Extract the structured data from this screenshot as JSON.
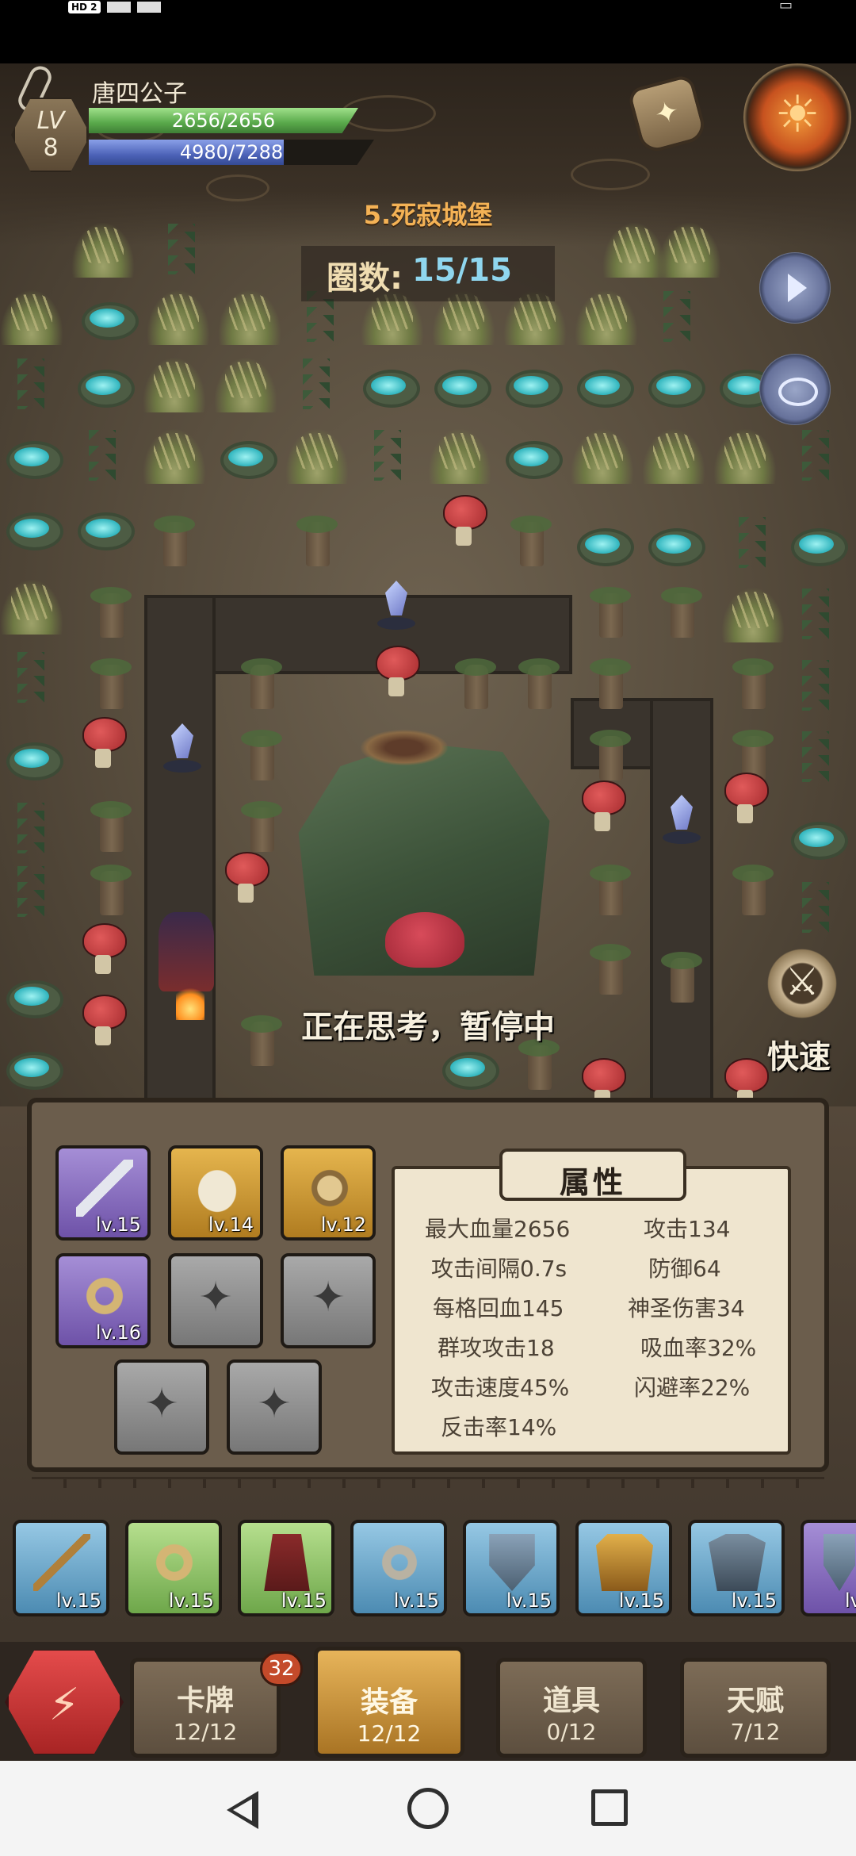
{
  "status_bar": {
    "network_badge": "HD 2"
  },
  "player": {
    "name": "唐四公子",
    "level_label": "LV",
    "level": "8",
    "hp_text": "2656/2656",
    "hp_fraction": 1.0,
    "exp_text": "4980/7288",
    "exp_fraction": 0.683
  },
  "stage": {
    "name": "5.死寂城堡",
    "round_label": "圈数:",
    "round_value": "15/15"
  },
  "status_message": "正在思考，暂停中",
  "speed_button_label": "快速",
  "equipped_slots": [
    {
      "item": "sword-icon",
      "rarity": "purple",
      "level": "lv.15"
    },
    {
      "item": "armor-icon",
      "rarity": "gold",
      "level": "lv.14"
    },
    {
      "item": "shield-icon",
      "rarity": "gold",
      "level": "lv.12"
    },
    {
      "item": "ring-icon",
      "rarity": "purple",
      "level": "lv.16"
    },
    {
      "item": "empty-slot-icon",
      "rarity": "empty",
      "level": ""
    },
    {
      "item": "empty-slot-icon",
      "rarity": "empty",
      "level": ""
    },
    {
      "item": "empty-slot-icon",
      "rarity": "empty",
      "level": ""
    },
    {
      "item": "empty-slot-icon",
      "rarity": "empty",
      "level": ""
    }
  ],
  "attributes": {
    "title": "属性",
    "max_hp": "最大血量2656",
    "attack": "攻击134",
    "attack_interval": "攻击间隔0.7s",
    "defense": "防御64",
    "regen": "每格回血145",
    "holy_damage": "神圣伤害34",
    "aoe_attack": "群攻攻击18",
    "lifesteal": "吸血率32%",
    "attack_speed": "攻击速度45%",
    "dodge": "闪避率22%",
    "counter": "反击率14%"
  },
  "inventory": [
    {
      "item": "staff-icon",
      "rarity": "blue",
      "level": "lv.15"
    },
    {
      "item": "ring-icon",
      "rarity": "green",
      "level": "lv.15"
    },
    {
      "item": "robe-icon",
      "rarity": "green",
      "level": "lv.15"
    },
    {
      "item": "band-icon",
      "rarity": "blue",
      "level": "lv.15"
    },
    {
      "item": "shield-icon",
      "rarity": "blue",
      "level": "lv.15"
    },
    {
      "item": "helmet-icon",
      "rarity": "blue",
      "level": "lv.15"
    },
    {
      "item": "chainmail-icon",
      "rarity": "blue",
      "level": "lv.15"
    },
    {
      "item": "shield-icon",
      "rarity": "purple",
      "level": "lv"
    }
  ],
  "nav": {
    "cards": {
      "label": "卡牌",
      "count": "12/12",
      "badge": "32"
    },
    "equipment": {
      "label": "装备",
      "count": "12/12"
    },
    "items": {
      "label": "道具",
      "count": "0/12"
    },
    "talents": {
      "label": "天赋",
      "count": "7/12"
    }
  }
}
